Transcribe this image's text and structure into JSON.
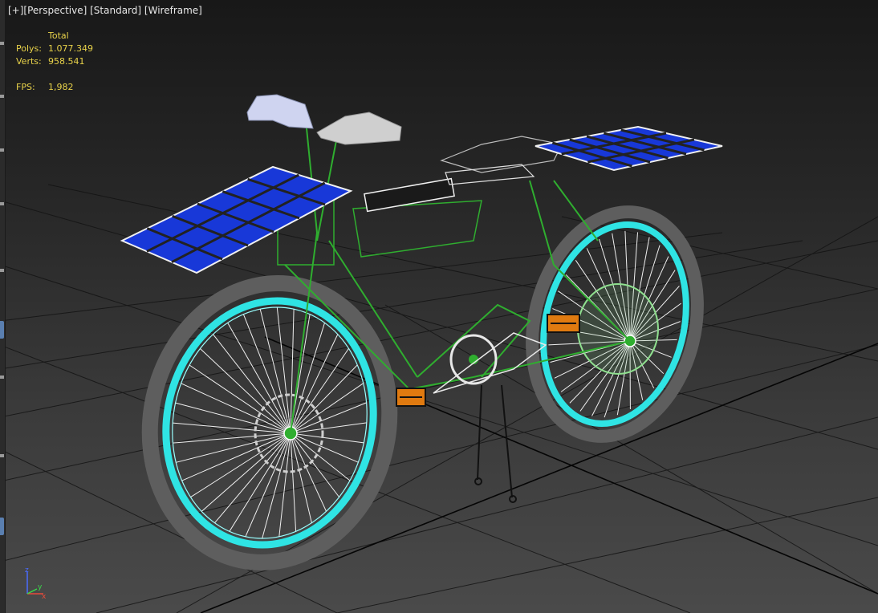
{
  "viewport": {
    "labels": [
      "[+]",
      "[Perspective]",
      "[Standard]",
      "[Wireframe]"
    ]
  },
  "stats": {
    "header": "Total",
    "polys_label": "Polys:",
    "polys_value": "1.077.349",
    "verts_label": "Verts:",
    "verts_value": "958.541",
    "fps_label": "FPS:",
    "fps_value": "1,982"
  },
  "gizmo": {
    "z_label": "z",
    "x_label": "x",
    "y_label": "y"
  },
  "colors": {
    "frame_green": "#2fae2f",
    "wheel_cyan": "#2fe4e4",
    "solar_blue": "#1838d8",
    "stats_yellow": "#e8d24a",
    "pedal_orange": "#e07a10",
    "grid_line": "#0e0e0e"
  }
}
